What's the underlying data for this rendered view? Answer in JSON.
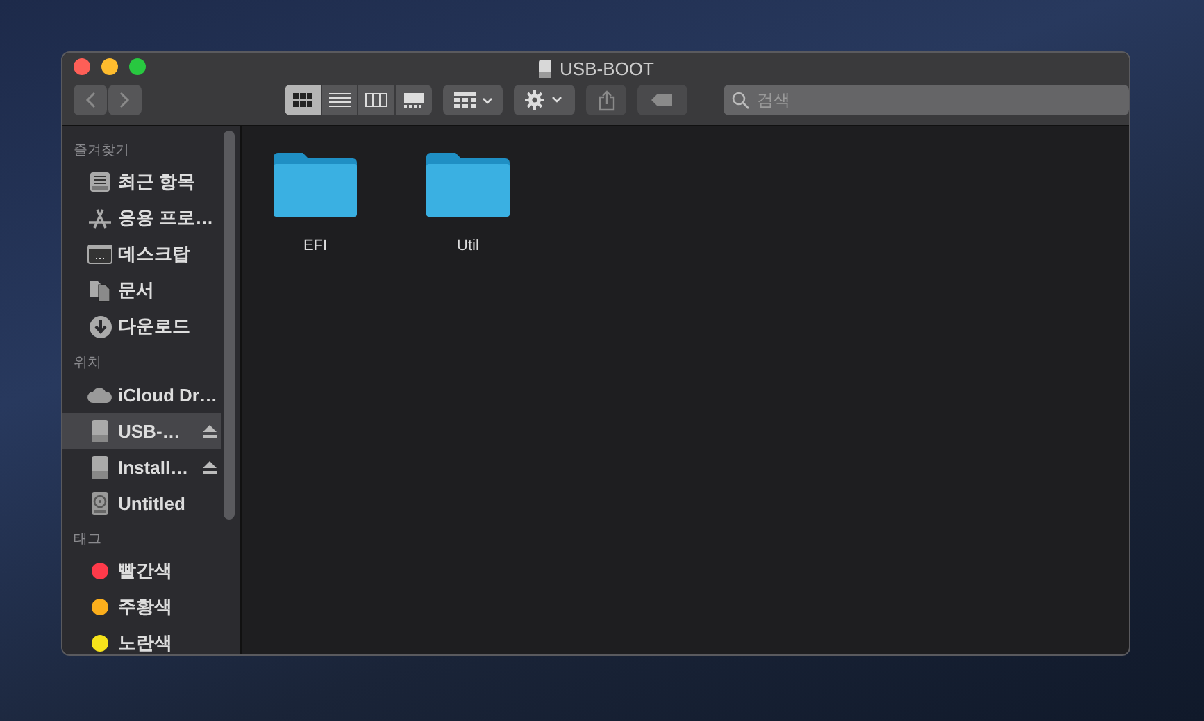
{
  "window": {
    "title": "USB-BOOT"
  },
  "toolbar": {
    "view_modes": [
      {
        "kind": "icons",
        "selected": true
      },
      {
        "kind": "list",
        "selected": false
      },
      {
        "kind": "columns",
        "selected": false
      },
      {
        "kind": "gallery",
        "selected": false
      }
    ],
    "search": {
      "placeholder": "검색"
    }
  },
  "sidebar": {
    "sections": [
      {
        "heading": "즐겨찾기",
        "items": [
          {
            "kind": "recent",
            "label": "최근 항목",
            "selected": false,
            "ejectable": false
          },
          {
            "kind": "apps",
            "label": "응용 프로…",
            "selected": false,
            "ejectable": false
          },
          {
            "kind": "desktop",
            "label": "데스크탑",
            "selected": false,
            "ejectable": false
          },
          {
            "kind": "documents",
            "label": "문서",
            "selected": false,
            "ejectable": false
          },
          {
            "kind": "downloads",
            "label": "다운로드",
            "selected": false,
            "ejectable": false
          }
        ]
      },
      {
        "heading": "위치",
        "items": [
          {
            "kind": "cloud",
            "label": "iCloud Dr…",
            "selected": false,
            "ejectable": false
          },
          {
            "kind": "drive",
            "label": "USB-…",
            "selected": true,
            "ejectable": true
          },
          {
            "kind": "drive",
            "label": "Install…",
            "selected": false,
            "ejectable": true
          },
          {
            "kind": "disk",
            "label": "Untitled",
            "selected": false,
            "ejectable": false
          }
        ]
      },
      {
        "heading": "태그",
        "items": [
          {
            "kind": "tag",
            "label": "빨간색",
            "color": "#fe3a4a",
            "selected": false,
            "ejectable": false
          },
          {
            "kind": "tag",
            "label": "주황색",
            "color": "#fbae1c",
            "selected": false,
            "ejectable": false
          },
          {
            "kind": "tag",
            "label": "노란색",
            "color": "#f6e31b",
            "selected": false,
            "ejectable": false
          }
        ]
      }
    ]
  },
  "files": [
    {
      "name": "EFI"
    },
    {
      "name": "Util"
    }
  ]
}
